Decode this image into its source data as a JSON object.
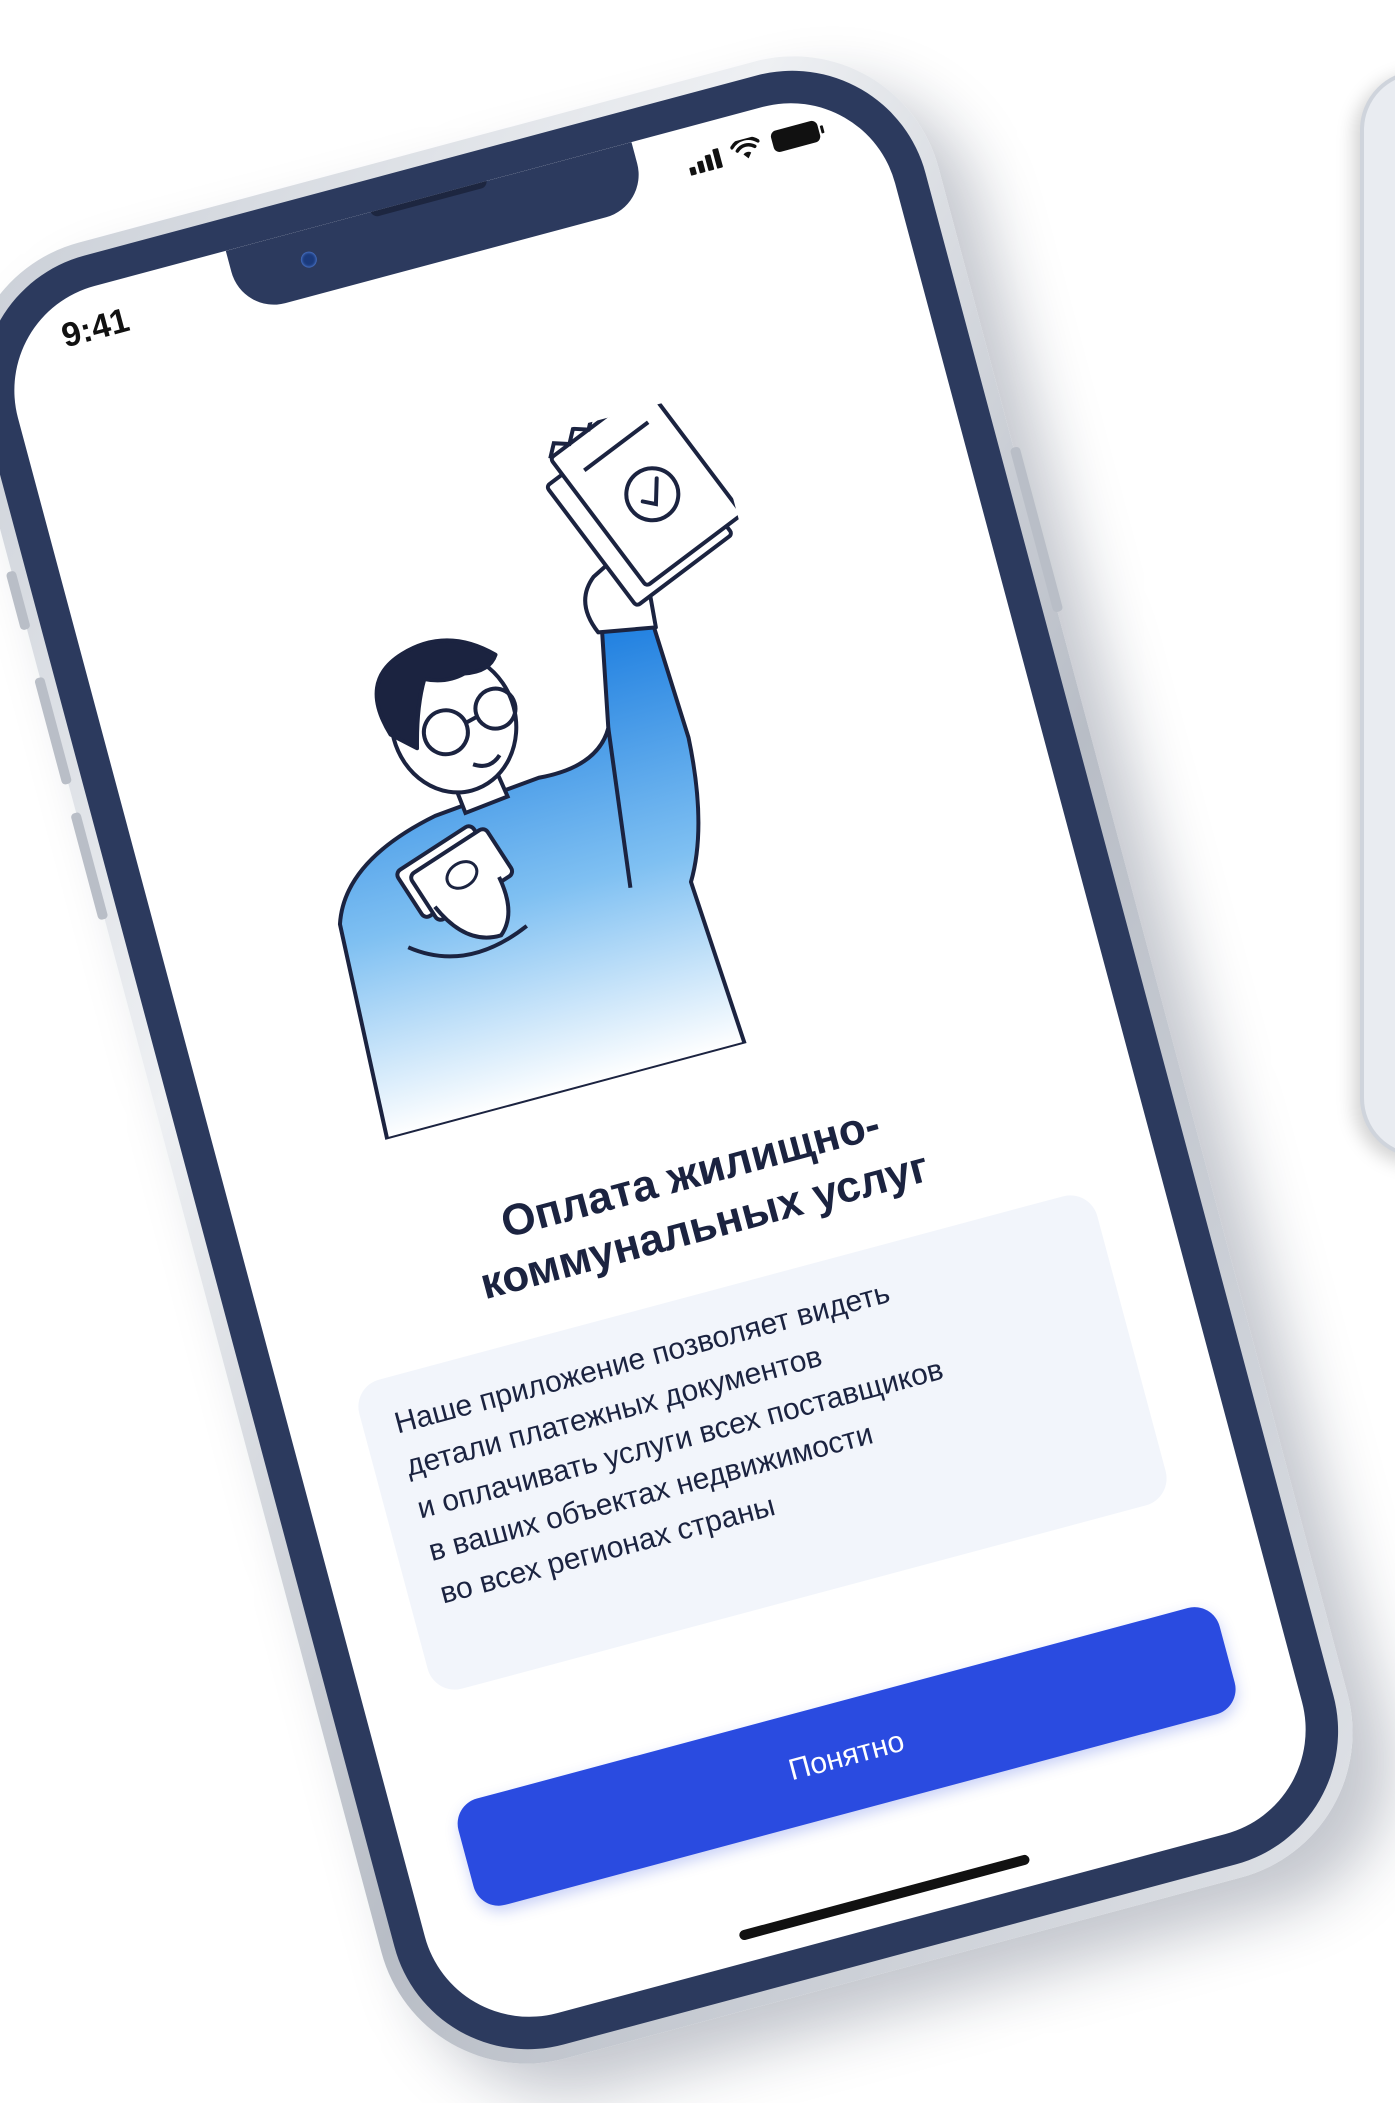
{
  "status_bar": {
    "time": "9:41"
  },
  "onboarding": {
    "title": "Оплата жилищно-\nкоммунальных услуг",
    "description": "Наше приложение позволяет видеть\nдетали платежных документов\nи оплачивать услуги всех поставщиков\nв ваших объектах недвижимости\nво всех регионах страны",
    "button_label": "Понятно",
    "illustration": "person-holding-receipt-and-money-illustration"
  },
  "colors": {
    "accent": "#2a4be0",
    "title_text": "#1b2340",
    "card_bg": "#f2f5fb",
    "bezel": "#2c3a5e",
    "illustration_gradient_top": "#2a8fe0",
    "illustration_gradient_bottom": "#ffffff"
  },
  "icons": {
    "signal": "cellular-signal-icon",
    "wifi": "wifi-icon",
    "battery": "battery-icon"
  }
}
